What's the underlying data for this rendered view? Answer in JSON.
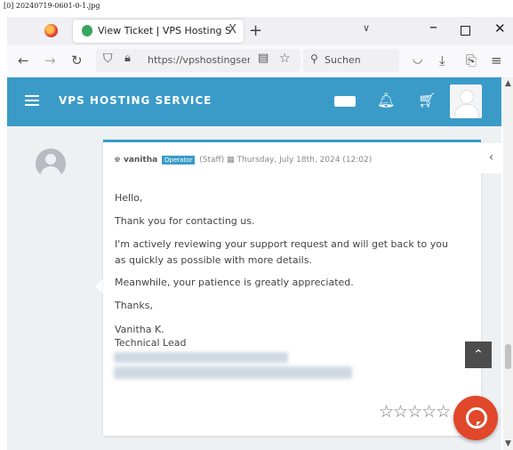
{
  "filename": "[0] 20240719-0601-0-1.jpg",
  "browser": {
    "tab_title": "View Ticket | VPS Hosting Servic",
    "tab_close": "X",
    "new_tab": "+",
    "tab_list": "∨",
    "url": "https://vpshostingservice",
    "search_placeholder": "Suchen"
  },
  "header": {
    "brand": "VPS HOSTING SERVICE"
  },
  "ticket": {
    "author": "vanitha",
    "role_badge": "Operator",
    "staff_tag": "(Staff)",
    "datetime": "Thursday, July 18th, 2024 (12:02)",
    "lines": [
      "Hello,",
      "Thank you for contacting us.",
      "I'm actively reviewing your support request and will get back to you",
      "as quickly as possible with more details.",
      "Meanwhile, your patience is greatly appreciated.",
      "Thanks,",
      "Vanitha K.",
      "Technical Lead"
    ],
    "rating_stars": 0,
    "rating_max": 5
  },
  "icons": {
    "collapse": "‹",
    "scroll_top": "⌃"
  },
  "colors": {
    "header_bg": "#3a9bc8",
    "badge_bg": "#3a9bc8",
    "chat_button": "#e1472a"
  }
}
